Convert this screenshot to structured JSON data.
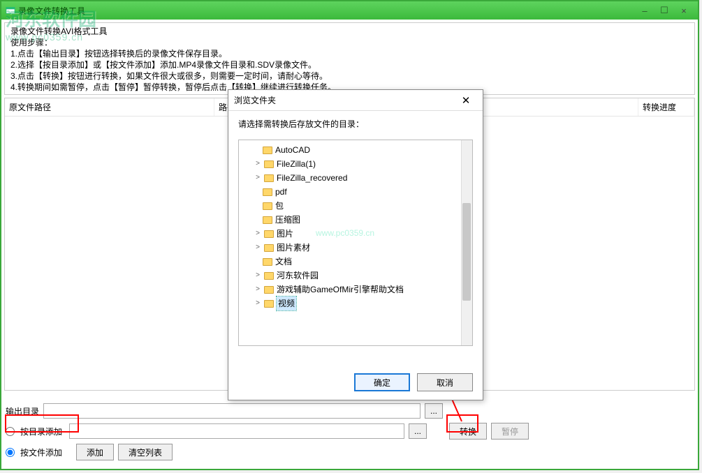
{
  "window": {
    "title": "录像文件转换工具",
    "min": "–",
    "max": "☐",
    "close": "×"
  },
  "watermark": {
    "name": "河东软件园",
    "url": "www.pc0359.cn"
  },
  "instructions": {
    "title": "录像文件转换AVI格式工具",
    "steps_label": "使用步骤：",
    "step1": "1.点击【输出目录】按钮选择转换后的录像文件保存目录。",
    "step2": "2.选择【按目录添加】或【按文件添加】添加.MP4录像文件目录和.SDV录像文件。",
    "step3": "3.点击【转换】按钮进行转换，如果文件很大或很多，则需要一定时间，请耐心等待。",
    "step4": "4.转换期间如需暂停，点击【暂停】暂停转换，暂停后点击【转换】继续进行转换任务。"
  },
  "columns": {
    "c1": "原文件路径",
    "c2": "路径",
    "c3": "转换进度"
  },
  "bottom": {
    "output_label": "输出目录",
    "output_value": "",
    "dots": "...",
    "by_folder": "按目录添加",
    "by_file": "按文件添加",
    "add_btn": "添加",
    "clear_btn": "清空列表",
    "convert_btn": "转换",
    "pause_btn": "暂停"
  },
  "dialog": {
    "title": "浏览文件夹",
    "close": "✕",
    "message": "请选择需转换后存放文件的目录：",
    "watermark_mid": "www.pc0359.cn",
    "items": [
      {
        "label": "AutoCAD",
        "expandable": false
      },
      {
        "label": "FileZilla(1)",
        "expandable": true
      },
      {
        "label": "FileZilla_recovered",
        "expandable": true
      },
      {
        "label": "pdf",
        "expandable": false
      },
      {
        "label": "包",
        "expandable": false
      },
      {
        "label": "压缩图",
        "expandable": false
      },
      {
        "label": "图片",
        "expandable": true
      },
      {
        "label": "图片素材",
        "expandable": true
      },
      {
        "label": "文档",
        "expandable": false
      },
      {
        "label": "河东软件园",
        "expandable": true
      },
      {
        "label": "游戏辅助GameOfMir引擎帮助文档",
        "expandable": true
      },
      {
        "label": "视频",
        "expandable": true,
        "selected": true
      }
    ],
    "ok": "确定",
    "cancel": "取消"
  }
}
